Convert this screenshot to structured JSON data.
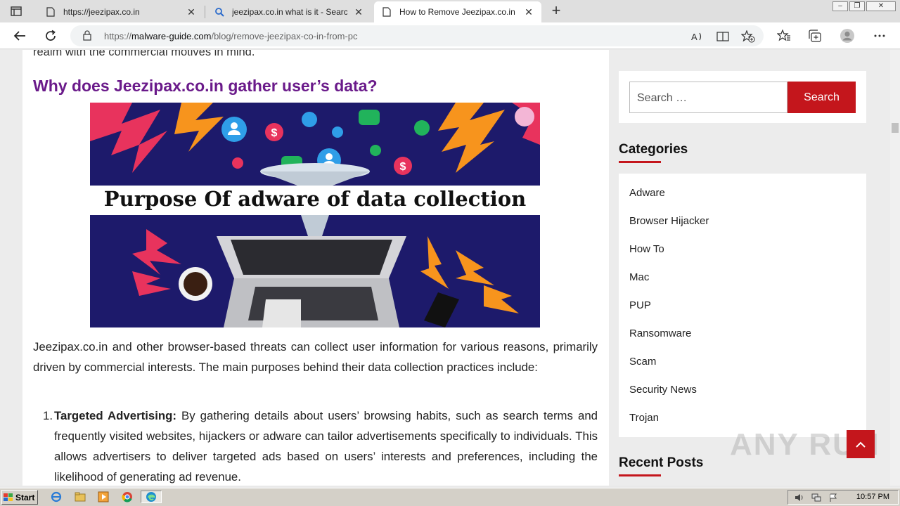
{
  "browser": {
    "tabs": [
      {
        "title": "https://jeezipax.co.in",
        "active": false
      },
      {
        "title": "jeezipax.co.in what is it - Search",
        "active": false
      },
      {
        "title": "How to Remove Jeezipax.co.in f",
        "active": true
      }
    ],
    "url_prefix": "https://",
    "url_host": "malware-guide.com",
    "url_path": "/blog/remove-jeezipax-co-in-from-pc"
  },
  "article": {
    "cut_line": "realm with the commercial motives in mind.",
    "heading": "Why does Jeezipax.co.in gather user’s data?",
    "image_caption": "Purpose Of adware of data collection",
    "paragraph": "Jeezipax.co.in and other browser-based threats can collect user information for various reasons, primarily driven by commercial interests. The main purposes behind their data collection practices include:",
    "list": [
      {
        "num": "1.",
        "term": "Targeted Advertising:",
        "text": " By gathering details about users’ browsing habits, such as search terms and frequently visited websites, hijackers or adware can tailor advertisements specifically to individuals. This allows advertisers to deliver targeted ads based on users’ interests and preferences, including the likelihood of generating ad revenue."
      }
    ]
  },
  "sidebar": {
    "search_placeholder": "Search …",
    "search_button": "Search",
    "categories_title": "Categories",
    "categories": [
      "Adware",
      "Browser Hijacker",
      "How To",
      "Mac",
      "PUP",
      "Ransomware",
      "Scam",
      "Security News",
      "Trojan"
    ],
    "recent_posts_title": "Recent Posts"
  },
  "watermark": "ANY RUN",
  "taskbar": {
    "start_label": "Start",
    "clock": "10:57 PM"
  },
  "colors": {
    "accent_red": "#c4161c",
    "heading_purple": "#6a1a8a",
    "hero_bg": "#1d1a6b"
  }
}
